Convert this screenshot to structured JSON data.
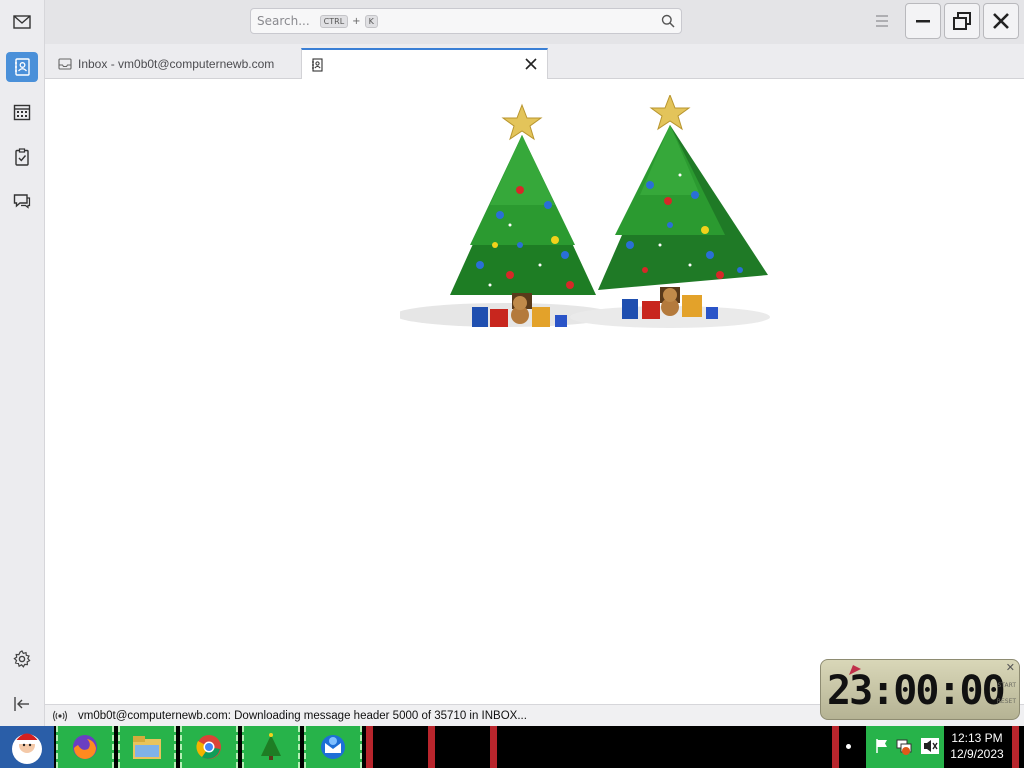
{
  "search": {
    "placeholder": "Search...",
    "key1": "CTRL",
    "plus": "+",
    "key2": "K"
  },
  "tabs": [
    {
      "label": "Inbox - vm0b0t@computernewb.com"
    },
    {
      "label": ""
    }
  ],
  "status": {
    "text": "vm0b0t@computernewb.com: Downloading message header 5000 of 35710 in INBOX..."
  },
  "clock_gadget": {
    "time": "23:00:00",
    "meta_top": "START",
    "meta_bottom": "RESET"
  },
  "tray": {
    "time": "12:13 PM",
    "date": "12/9/2023"
  },
  "colors": {
    "accent": "#3a7fd5",
    "taskbar_app": "#27b34a",
    "taskbar_sep": "#b8252c"
  }
}
